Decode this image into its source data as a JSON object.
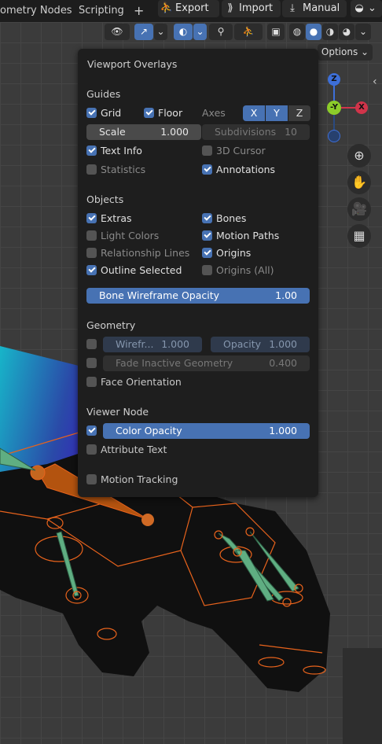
{
  "topbar": {
    "tabs": [
      "ometry Nodes",
      "Scripting"
    ],
    "add_tab": "+",
    "export_label": "Export",
    "import_label": "Import",
    "manual_label": "Manual"
  },
  "viewport": {
    "options_label": "Options"
  },
  "gizmo": {
    "z": "Z",
    "y": "-Y",
    "x": "X"
  },
  "overlays": {
    "title": "Viewport Overlays",
    "guides": {
      "heading": "Guides",
      "grid": "Grid",
      "floor": "Floor",
      "axes_label": "Axes",
      "axes": [
        "X",
        "Y",
        "Z"
      ],
      "scale_label": "Scale",
      "scale_value": "1.000",
      "subdivisions_label": "Subdivisions",
      "subdivisions_value": "10",
      "text_info": "Text Info",
      "cursor_3d": "3D Cursor",
      "statistics": "Statistics",
      "annotations": "Annotations"
    },
    "objects": {
      "heading": "Objects",
      "extras": "Extras",
      "bones": "Bones",
      "light_colors": "Light Colors",
      "motion_paths": "Motion Paths",
      "relationship_lines": "Relationship Lines",
      "origins": "Origins",
      "outline_selected": "Outline Selected",
      "origins_all": "Origins (All)",
      "bone_wire_label": "Bone Wireframe Opacity",
      "bone_wire_value": "1.00"
    },
    "geometry": {
      "heading": "Geometry",
      "wireframe_label": "Wirefr...",
      "wireframe_value": "1.000",
      "opacity_label": "Opacity",
      "opacity_value": "1.000",
      "fade_label": "Fade Inactive Geometry",
      "fade_value": "0.400",
      "face_orientation": "Face Orientation"
    },
    "viewer_node": {
      "heading": "Viewer Node",
      "color_opacity_label": "Color Opacity",
      "color_opacity_value": "1.000",
      "attribute_text": "Attribute Text"
    },
    "motion_tracking": "Motion Tracking"
  }
}
